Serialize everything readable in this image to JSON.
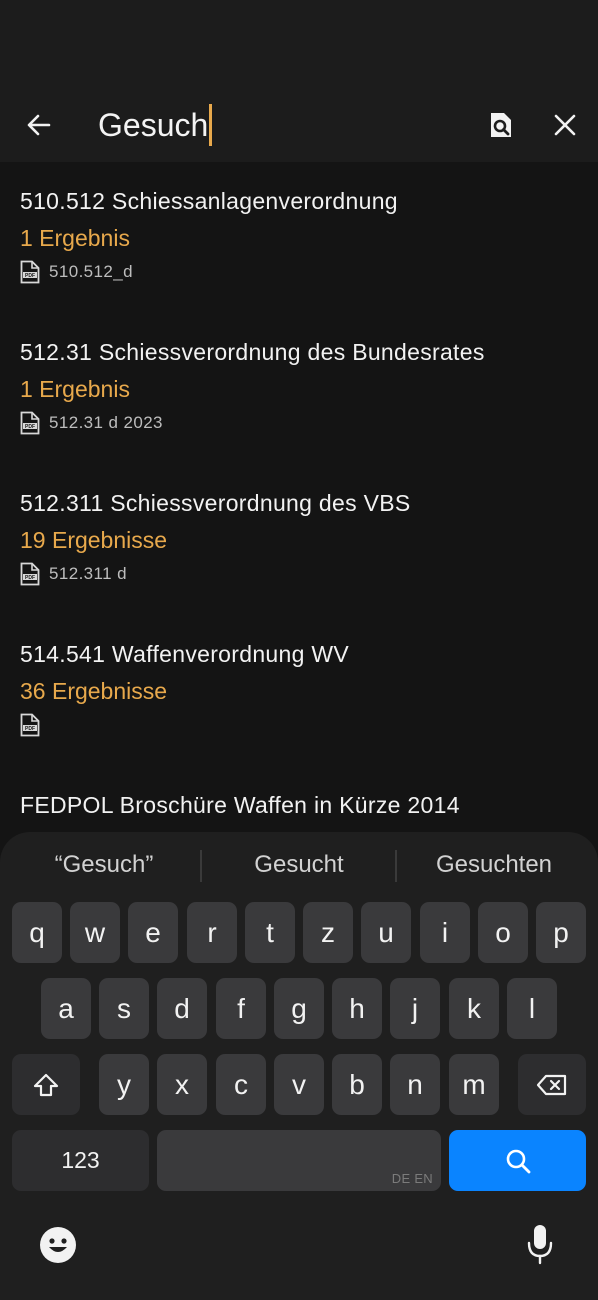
{
  "header": {
    "search_value": "Gesuch",
    "back_icon": "arrow-left-icon",
    "search_doc_icon": "document-search-icon",
    "close_icon": "close-icon"
  },
  "results": [
    {
      "title": "510.512 Schiessanlagenverordnung",
      "count": "1 Ergebnis",
      "file": "510.512_d"
    },
    {
      "title": "512.31 Schiessverordnung des Bundesrates",
      "count": "1 Ergebnis",
      "file": "512.31 d 2023"
    },
    {
      "title": "512.311 Schiessverordnung des VBS",
      "count": "19 Ergebnisse",
      "file": "512.311 d"
    },
    {
      "title": "514.541 Waffenverordnung WV",
      "count": "36 Ergebnisse",
      "file": ""
    },
    {
      "title": "FEDPOL Broschüre Waffen in Kürze 2014"
    }
  ],
  "keyboard": {
    "suggestions": [
      "“Gesuch”",
      "Gesucht",
      "Gesuchten"
    ],
    "row1": [
      "q",
      "w",
      "e",
      "r",
      "t",
      "z",
      "u",
      "i",
      "o",
      "p"
    ],
    "row2": [
      "a",
      "s",
      "d",
      "f",
      "g",
      "h",
      "j",
      "k",
      "l"
    ],
    "row3": [
      "y",
      "x",
      "c",
      "v",
      "b",
      "n",
      "m"
    ],
    "numbers_label": "123",
    "space_lang_hint": "DE EN",
    "colors": {
      "accent": "#e8a94c",
      "action_key": "#0a84ff",
      "key": "#3a3a3c"
    }
  }
}
